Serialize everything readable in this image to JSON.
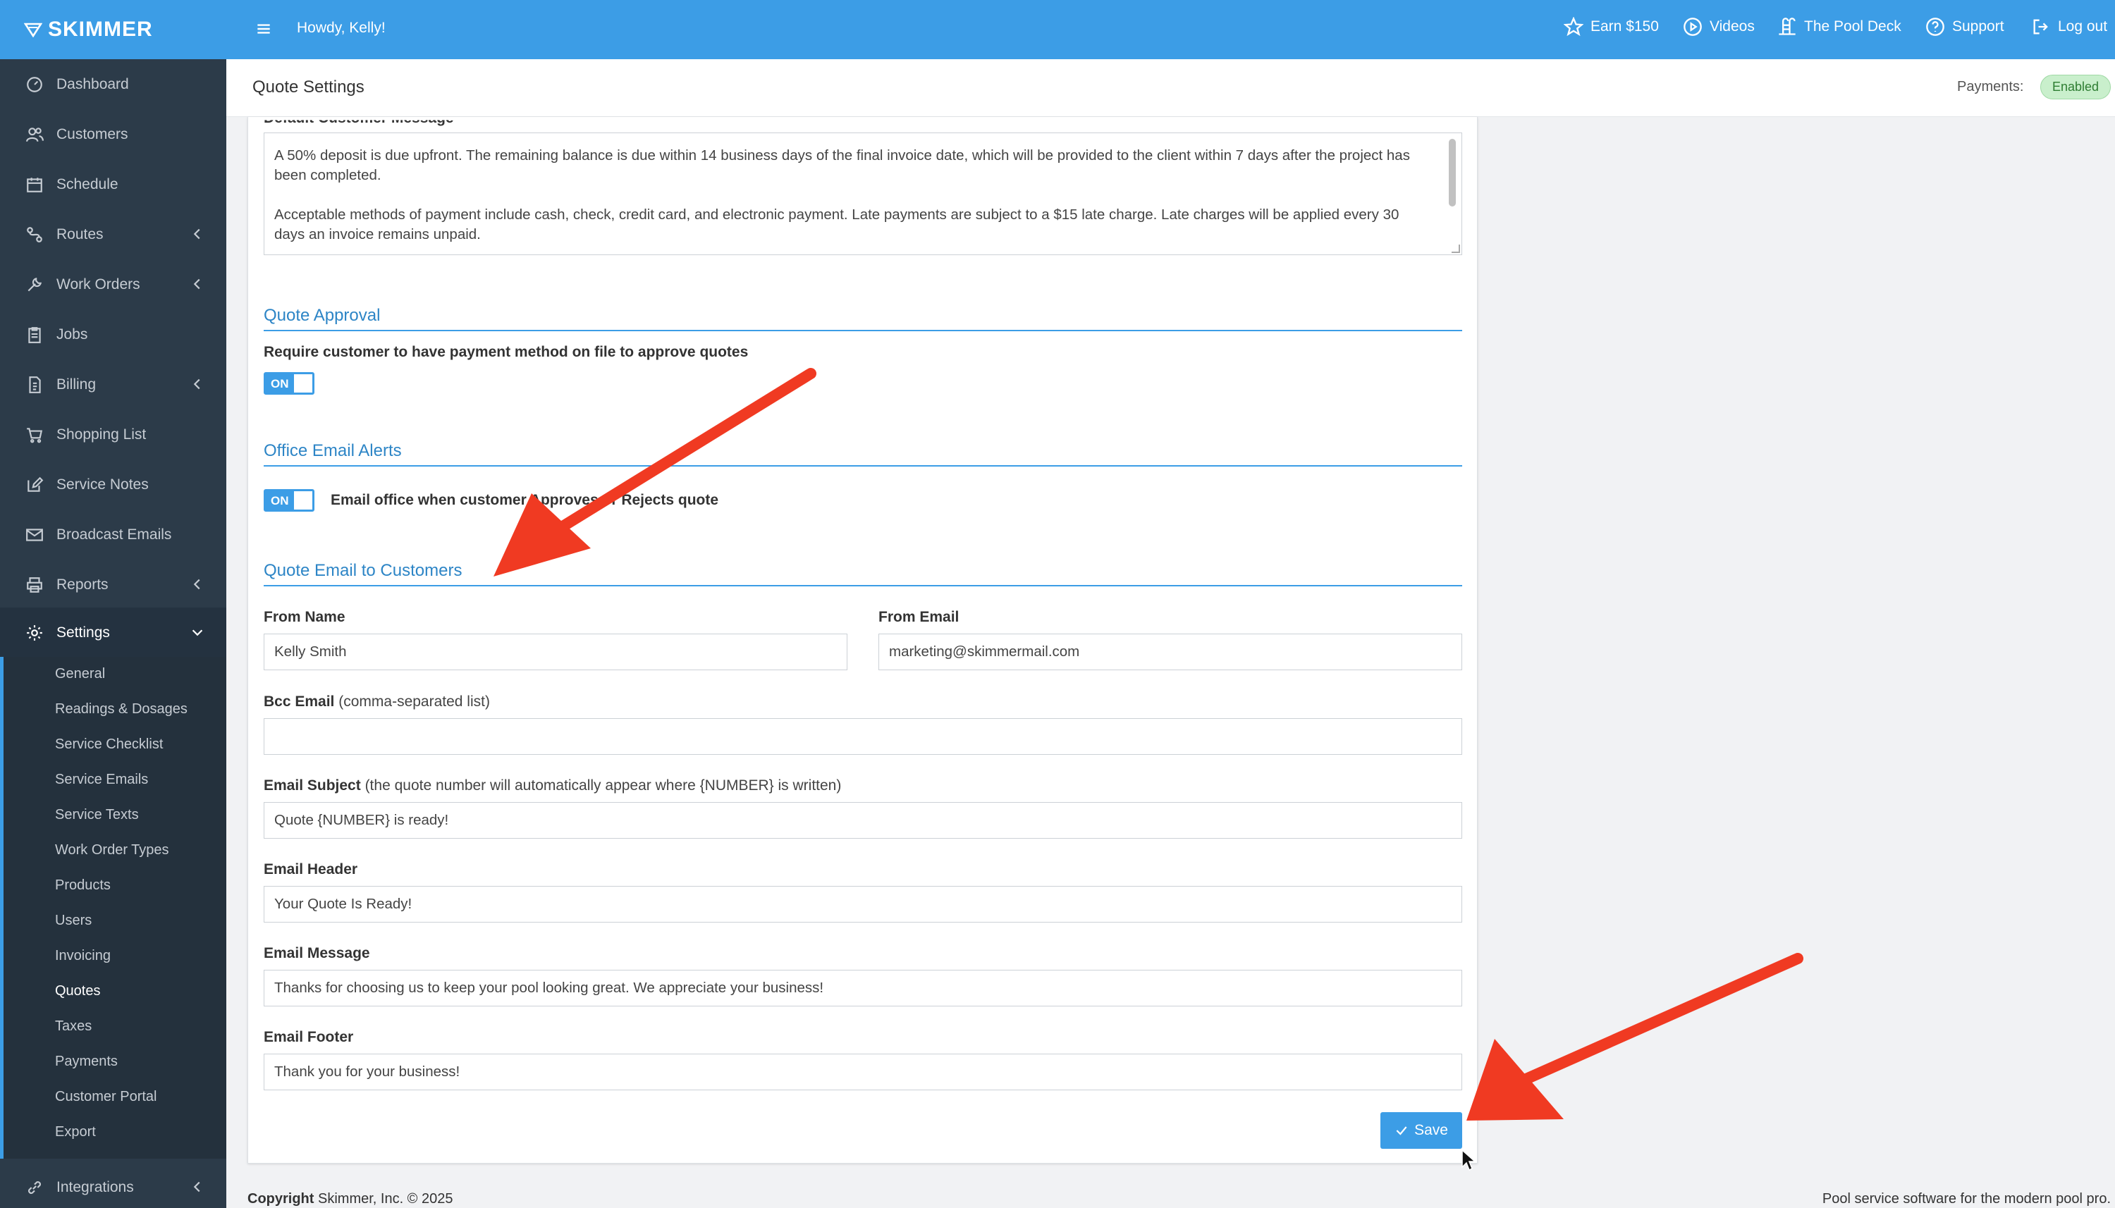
{
  "brand": {
    "name": "SKIMMER"
  },
  "topbar": {
    "greeting": "Howdy, Kelly!",
    "links": {
      "earn": "Earn $150",
      "videos": "Videos",
      "pool_deck": "The Pool Deck",
      "support": "Support",
      "logout": "Log out"
    }
  },
  "sidebar": {
    "items": {
      "dashboard": "Dashboard",
      "customers": "Customers",
      "schedule": "Schedule",
      "routes": "Routes",
      "work_orders": "Work Orders",
      "jobs": "Jobs",
      "billing": "Billing",
      "shopping_list": "Shopping List",
      "service_notes": "Service Notes",
      "broadcast_emails": "Broadcast Emails",
      "reports": "Reports",
      "settings": "Settings",
      "integrations": "Integrations"
    },
    "settings_sub": {
      "general": "General",
      "readings": "Readings & Dosages",
      "checklist": "Service Checklist",
      "emails": "Service Emails",
      "texts": "Service Texts",
      "wo_types": "Work Order Types",
      "products": "Products",
      "users": "Users",
      "invoicing": "Invoicing",
      "quotes": "Quotes",
      "taxes": "Taxes",
      "payments": "Payments",
      "portal": "Customer Portal",
      "export": "Export"
    }
  },
  "page": {
    "title": "Quote Settings",
    "payments_label": "Payments:",
    "payments_status": "Enabled"
  },
  "form": {
    "default_message_label": "Default Customer Message",
    "default_message_p1": "A 50% deposit is due upfront. The remaining balance is due within 14 business days of the final invoice date, which will be provided to the client within 7 days after the project has been completed.",
    "default_message_p2": "Acceptable methods of payment include cash, check, credit card, and electronic payment. Late payments are subject to a $15 late charge. Late charges will be applied every 30 days an invoice remains unpaid.",
    "quote_approval": {
      "title": "Quote Approval",
      "require_label": "Require customer to have payment method on file to approve quotes",
      "toggle": "ON"
    },
    "office_alerts": {
      "title": "Office Email Alerts",
      "toggle": "ON",
      "label": "Email office when customer Approves or Rejects quote"
    },
    "quote_email": {
      "title": "Quote Email to Customers",
      "from_name_label": "From Name",
      "from_name_value": "Kelly Smith",
      "from_email_label": "From Email",
      "from_email_value": "marketing@skimmermail.com",
      "bcc_label": "Bcc Email",
      "bcc_hint": "(comma-separated list)",
      "bcc_value": "",
      "subject_label": "Email Subject",
      "subject_hint": "(the quote number will automatically appear where {NUMBER} is written)",
      "subject_value": "Quote {NUMBER} is ready!",
      "header_label": "Email Header",
      "header_value": "Your Quote Is Ready!",
      "message_label": "Email Message",
      "message_value": "Thanks for choosing us to keep your pool looking great. We appreciate your business!",
      "footer_label": "Email Footer",
      "footer_value": "Thank you for your business!"
    },
    "save": "Save"
  },
  "footer": {
    "copyright_bold": "Copyright",
    "copyright_rest": " Skimmer, Inc. © 2025",
    "tagline": "Pool service software for the modern pool pro."
  },
  "colors": {
    "primary": "#3c9de6",
    "sidebar": "#2c3b49",
    "annotation": "#f03a22"
  }
}
